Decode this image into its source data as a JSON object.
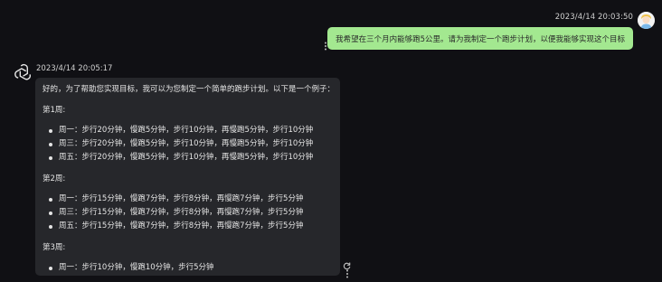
{
  "user_message": {
    "timestamp": "2023/4/14 20:03:50",
    "text": "我希望在三个月内能够跑5公里。请为我制定一个跑步计划，以便我能够实现这个目标",
    "avatar": "user-avatar",
    "bubble_color": "#a3e890"
  },
  "assistant_message": {
    "timestamp": "2023/4/14 20:05:17",
    "avatar": "openai-logo-icon",
    "bubble_color": "#26272b",
    "intro": "好的，为了帮助您实现目标，我可以为您制定一个简单的跑步计划。以下是一个例子：",
    "weeks": [
      {
        "title": "第1周:",
        "items": [
          "周一：步行20分钟，慢跑5分钟，步行10分钟，再慢跑5分钟，步行10分钟",
          "周三：步行20分钟，慢跑5分钟，步行10分钟，再慢跑5分钟，步行10分钟",
          "周五：步行20分钟，慢跑5分钟，步行10分钟，再慢跑5分钟，步行10分钟"
        ]
      },
      {
        "title": "第2周:",
        "items": [
          "周一：步行15分钟，慢跑7分钟，步行8分钟，再慢跑7分钟，步行5分钟",
          "周三：步行15分钟，慢跑7分钟，步行8分钟，再慢跑7分钟，步行5分钟",
          "周五：步行15分钟，慢跑7分钟，步行8分钟，再慢跑7分钟，步行5分钟"
        ]
      },
      {
        "title": "第3周:",
        "items": [
          "周一：步行10分钟，慢跑10分钟，步行5分钟"
        ]
      }
    ]
  },
  "icons": {
    "more": "vertical-ellipsis-icon",
    "regenerate": "refresh-icon"
  }
}
